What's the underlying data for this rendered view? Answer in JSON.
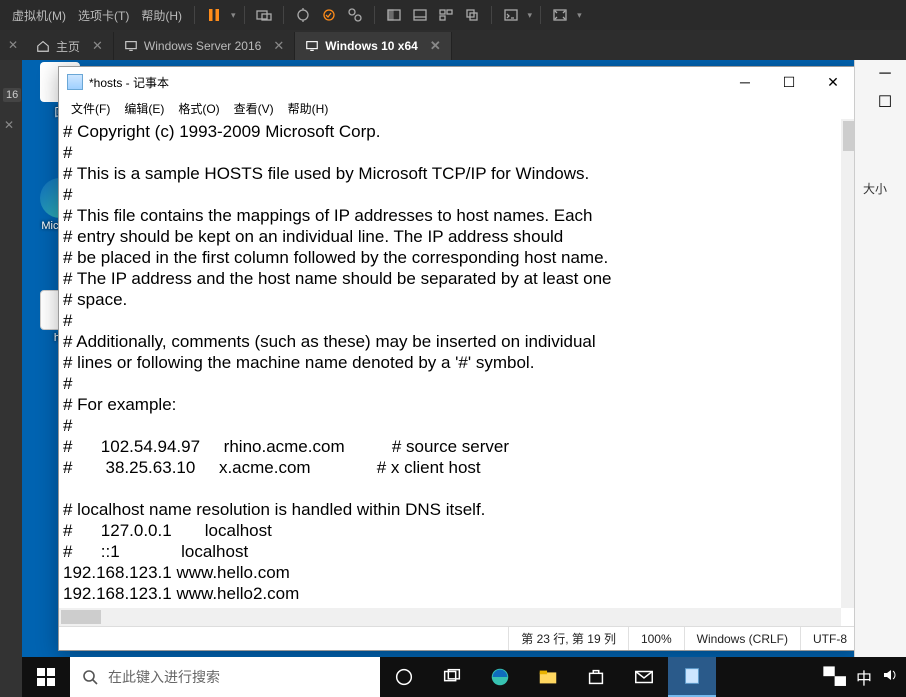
{
  "vm_menu": {
    "vm": "虚拟机(M)",
    "tabs": "选项卡(T)",
    "help": "帮助(H)"
  },
  "vm_tabs": {
    "home": "主页",
    "ws2016": "Windows Server 2016",
    "win10": "Windows 10 x64"
  },
  "left_number": "16",
  "desktop_icons": {
    "recycle": "回",
    "edge": "Micr\nEd",
    "host": "ho"
  },
  "notepad": {
    "title": "*hosts - 记事本",
    "menu": {
      "file": "文件(F)",
      "edit": "编辑(E)",
      "format": "格式(O)",
      "view": "查看(V)",
      "help": "帮助(H)"
    },
    "content": "# Copyright (c) 1993-2009 Microsoft Corp.\n#\n# This is a sample HOSTS file used by Microsoft TCP/IP for Windows.\n#\n# This file contains the mappings of IP addresses to host names. Each\n# entry should be kept on an individual line. The IP address should\n# be placed in the first column followed by the corresponding host name.\n# The IP address and the host name should be separated by at least one\n# space.\n#\n# Additionally, comments (such as these) may be inserted on individual\n# lines or following the machine name denoted by a '#' symbol.\n#\n# For example:\n#\n#      102.54.94.97     rhino.acme.com          # source server\n#       38.25.63.10     x.acme.com              # x client host\n\n# localhost name resolution is handled within DNS itself.\n#\t127.0.0.1       localhost\n#\t::1             localhost\n192.168.123.1 www.hello.com\n192.168.123.1 www.hello2.com",
    "status": {
      "pos": "第 23 行, 第 19 列",
      "zoom": "100%",
      "eol": "Windows (CRLF)",
      "enc": "UTF-8"
    }
  },
  "taskbar": {
    "search_placeholder": "在此键入进行搜索"
  },
  "right": {
    "size": "大小"
  }
}
